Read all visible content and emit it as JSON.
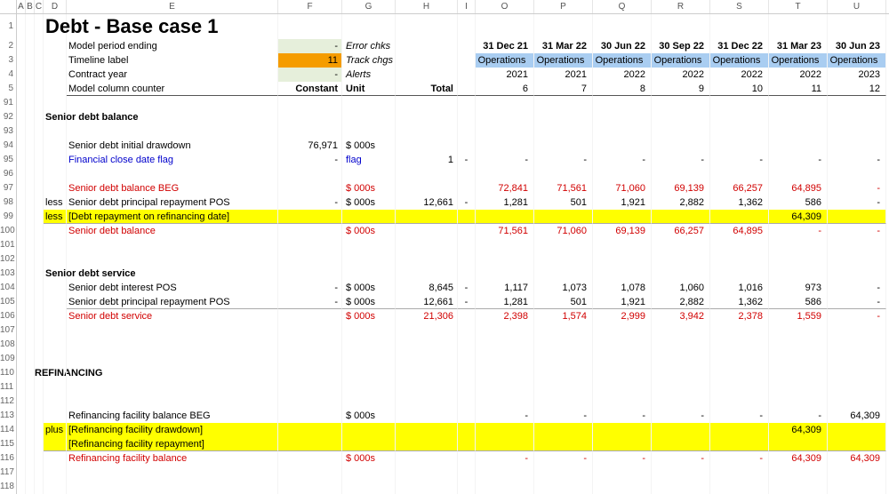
{
  "columns": {
    "rownum": "",
    "A": "A",
    "B": "B",
    "C": "C",
    "D": "D",
    "E": "E",
    "F": "F",
    "G": "G",
    "H": "H",
    "I": "I",
    "O": "O",
    "P": "P",
    "Q": "Q",
    "R": "R",
    "S": "S",
    "T": "T",
    "U": "U"
  },
  "title": "Debt - Base case 1",
  "r2": {
    "label": "Model period ending",
    "f": "-",
    "g": "Error chks",
    "dates": [
      "31 Dec 21",
      "31 Mar 22",
      "30 Jun 22",
      "30 Sep 22",
      "31 Dec 22",
      "31 Mar 23",
      "30 Jun 23"
    ]
  },
  "r3": {
    "label": "Timeline label",
    "f": "11",
    "g": "Track chgs",
    "ops": [
      "Operations",
      "Operations",
      "Operations",
      "Operations",
      "Operations",
      "Operations",
      "Operations"
    ]
  },
  "r4": {
    "label": "Contract year",
    "f": "-",
    "g": "Alerts",
    "yrs": [
      "2021",
      "2021",
      "2022",
      "2022",
      "2022",
      "2022",
      "2023"
    ]
  },
  "r5": {
    "label": "Model column counter",
    "f": "Constant",
    "g": "Unit",
    "h": "Total",
    "cnt": [
      "6",
      "7",
      "8",
      "9",
      "10",
      "11",
      "12"
    ]
  },
  "s92": "Senior debt balance",
  "r94": {
    "label": "Senior debt initial drawdown",
    "f": "76,971",
    "g": "$ 000s"
  },
  "r95": {
    "label": "Financial close date flag",
    "f": "-",
    "g": "flag",
    "h": "1",
    "i": "-",
    "vals": [
      "-",
      "-",
      "-",
      "-",
      "-",
      "-",
      "-"
    ]
  },
  "r97": {
    "label": "Senior debt balance BEG",
    "g": "$ 000s",
    "vals": [
      "72,841",
      "71,561",
      "71,060",
      "69,139",
      "66,257",
      "64,895",
      "-"
    ]
  },
  "r98": {
    "pfx": "less",
    "label": "Senior debt principal repayment POS",
    "f": "-",
    "g": "$ 000s",
    "h": "12,661",
    "i": "-",
    "vals": [
      "1,281",
      "501",
      "1,921",
      "2,882",
      "1,362",
      "586",
      "-"
    ]
  },
  "r99": {
    "pfx": "less",
    "label": "[Debt repayment on refinancing date]",
    "vals": [
      "",
      "",
      "",
      "",
      "",
      "64,309",
      ""
    ]
  },
  "r100": {
    "label": "Senior debt balance",
    "g": "$ 000s",
    "vals": [
      "71,561",
      "71,060",
      "69,139",
      "66,257",
      "64,895",
      "-",
      "-"
    ]
  },
  "s103": "Senior debt service",
  "r104": {
    "label": "Senior debt interest POS",
    "f": "-",
    "g": "$ 000s",
    "h": "8,645",
    "i": "-",
    "vals": [
      "1,117",
      "1,073",
      "1,078",
      "1,060",
      "1,016",
      "973",
      "-"
    ]
  },
  "r105": {
    "label": "Senior debt principal repayment POS",
    "f": "-",
    "g": "$ 000s",
    "h": "12,661",
    "i": "-",
    "vals": [
      "1,281",
      "501",
      "1,921",
      "2,882",
      "1,362",
      "586",
      "-"
    ]
  },
  "r106": {
    "label": "Senior debt service",
    "g": "$ 000s",
    "h": "21,306",
    "vals": [
      "2,398",
      "1,574",
      "2,999",
      "3,942",
      "2,378",
      "1,559",
      "-"
    ]
  },
  "s110": "REFINANCING",
  "r113": {
    "label": "Refinancing facility balance BEG",
    "g": "$ 000s",
    "vals": [
      "-",
      "-",
      "-",
      "-",
      "-",
      "-",
      "64,309"
    ]
  },
  "r114": {
    "pfx": "plus",
    "label": "[Refinancing facility drawdown]",
    "vals": [
      "",
      "",
      "",
      "",
      "",
      "64,309",
      ""
    ]
  },
  "r115": {
    "label": "[Refinancing facility repayment]"
  },
  "r116": {
    "label": "Refinancing facility balance",
    "g": "$ 000s",
    "vals": [
      "-",
      "-",
      "-",
      "-",
      "-",
      "64,309",
      "64,309"
    ]
  },
  "chart_data": {
    "type": "table",
    "title": "Debt - Base case 1",
    "column_dates": [
      "31 Dec 21",
      "31 Mar 22",
      "30 Jun 22",
      "30 Sep 22",
      "31 Dec 22",
      "31 Mar 23",
      "30 Jun 23"
    ],
    "series": [
      {
        "name": "Senior debt balance BEG",
        "unit": "$ 000s",
        "values": [
          72841,
          71561,
          71060,
          69139,
          66257,
          64895,
          null
        ]
      },
      {
        "name": "Senior debt principal repayment POS",
        "unit": "$ 000s",
        "total": 12661,
        "values": [
          1281,
          501,
          1921,
          2882,
          1362,
          586,
          null
        ]
      },
      {
        "name": "Debt repayment on refinancing date",
        "unit": "$ 000s",
        "values": [
          null,
          null,
          null,
          null,
          null,
          64309,
          null
        ]
      },
      {
        "name": "Senior debt balance",
        "unit": "$ 000s",
        "values": [
          71561,
          71060,
          69139,
          66257,
          64895,
          null,
          null
        ]
      },
      {
        "name": "Senior debt interest POS",
        "unit": "$ 000s",
        "total": 8645,
        "values": [
          1117,
          1073,
          1078,
          1060,
          1016,
          973,
          null
        ]
      },
      {
        "name": "Senior debt service",
        "unit": "$ 000s",
        "total": 21306,
        "values": [
          2398,
          1574,
          2999,
          3942,
          2378,
          1559,
          null
        ]
      },
      {
        "name": "Refinancing facility balance BEG",
        "unit": "$ 000s",
        "values": [
          null,
          null,
          null,
          null,
          null,
          null,
          64309
        ]
      },
      {
        "name": "Refinancing facility drawdown",
        "unit": "$ 000s",
        "values": [
          null,
          null,
          null,
          null,
          null,
          64309,
          null
        ]
      },
      {
        "name": "Refinancing facility balance",
        "unit": "$ 000s",
        "values": [
          null,
          null,
          null,
          null,
          null,
          64309,
          64309
        ]
      }
    ]
  }
}
